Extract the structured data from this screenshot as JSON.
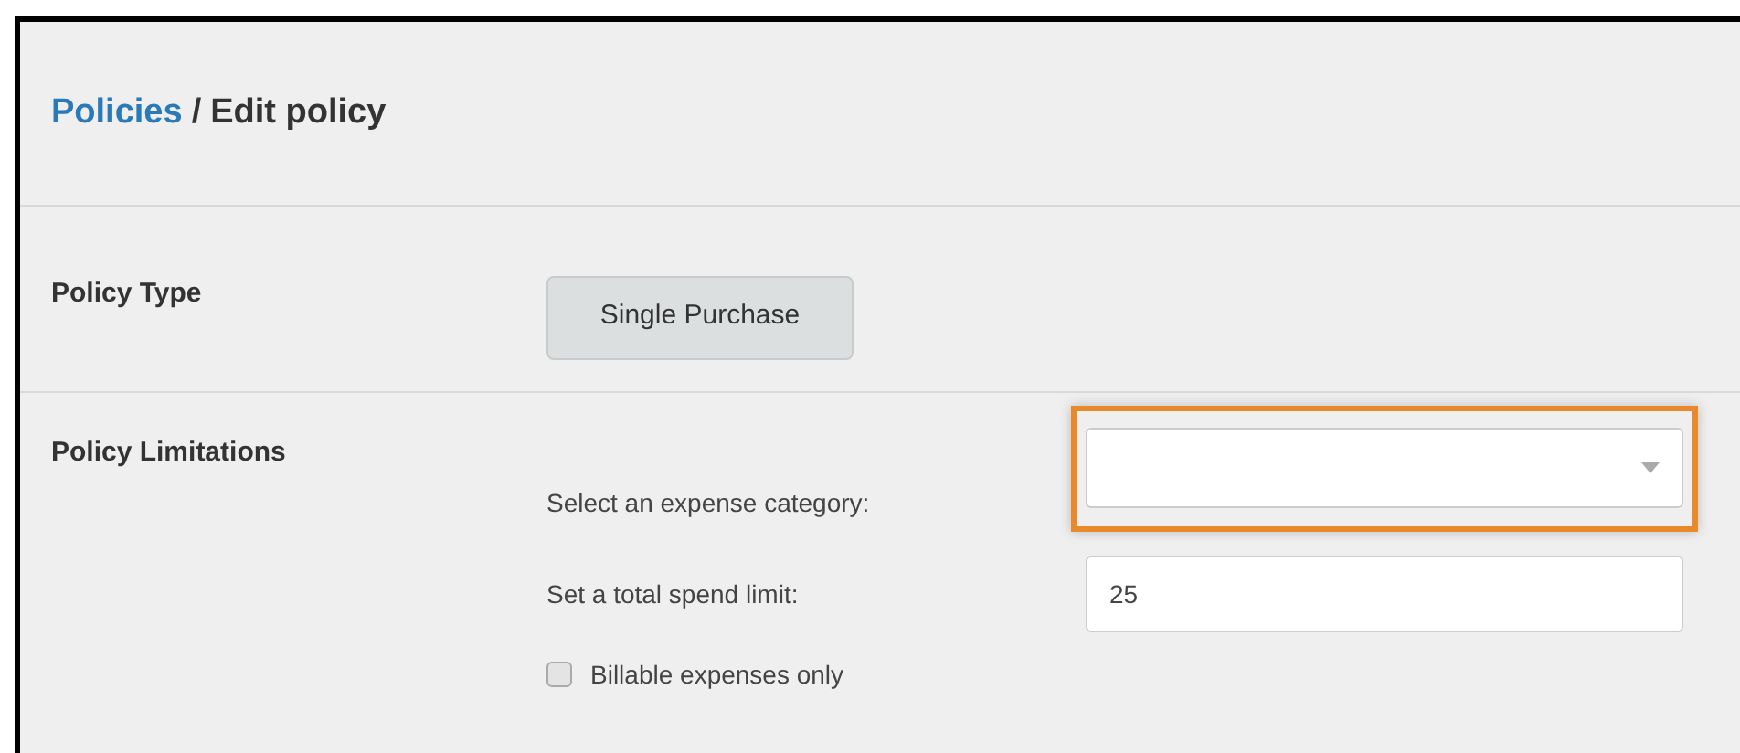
{
  "breadcrumb": {
    "link": "Policies",
    "separator": "/",
    "current": "Edit policy"
  },
  "policy_type": {
    "label": "Policy Type",
    "button": "Single Purchase"
  },
  "policy_limitations": {
    "label": "Policy Limitations",
    "category": {
      "label": "Select an expense category:",
      "highlighted": true
    },
    "spend_limit": {
      "label": "Set a total spend limit:",
      "value": "25"
    },
    "billable": {
      "label": "Billable expenses only",
      "checked": false
    }
  }
}
